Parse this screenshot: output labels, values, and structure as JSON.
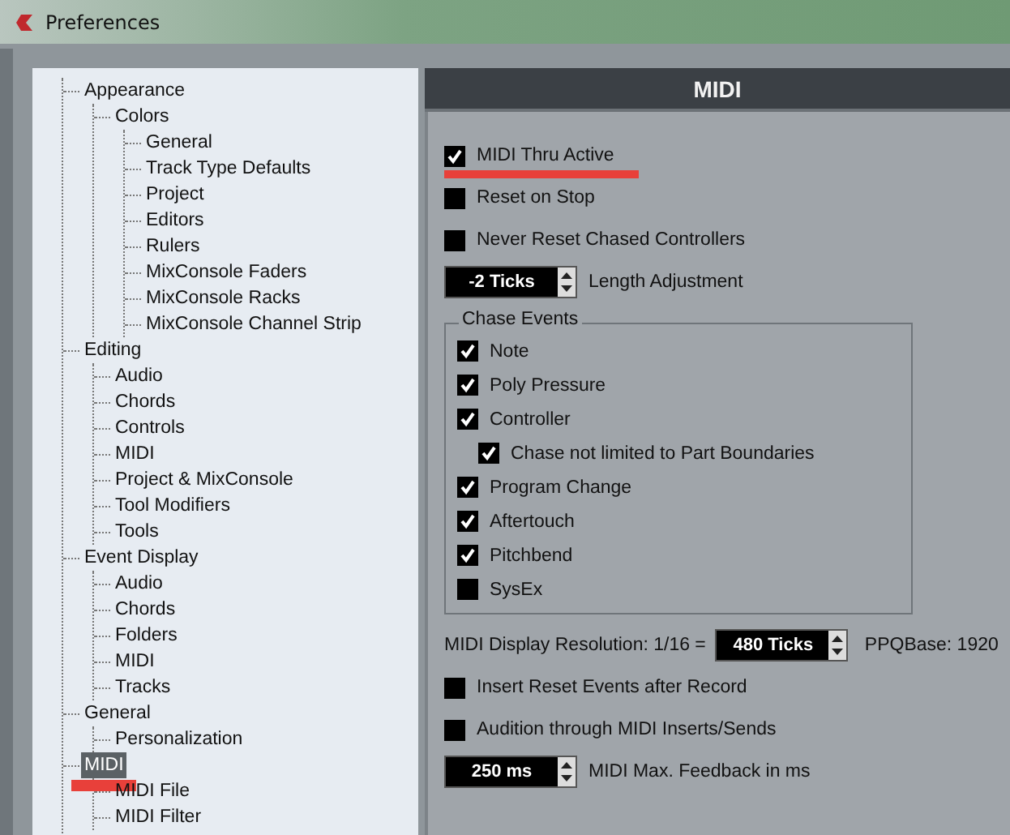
{
  "window": {
    "title": "Preferences"
  },
  "tree": [
    {
      "label": "Appearance",
      "selected": false,
      "children": [
        {
          "label": "Colors",
          "selected": false,
          "children": [
            {
              "label": "General",
              "selected": false
            },
            {
              "label": "Track Type Defaults",
              "selected": false
            },
            {
              "label": "Project",
              "selected": false
            },
            {
              "label": "Editors",
              "selected": false
            },
            {
              "label": "Rulers",
              "selected": false
            },
            {
              "label": "MixConsole Faders",
              "selected": false
            },
            {
              "label": "MixConsole Racks",
              "selected": false
            },
            {
              "label": "MixConsole Channel Strip",
              "selected": false
            }
          ]
        }
      ]
    },
    {
      "label": "Editing",
      "selected": false,
      "children": [
        {
          "label": "Audio",
          "selected": false
        },
        {
          "label": "Chords",
          "selected": false
        },
        {
          "label": "Controls",
          "selected": false
        },
        {
          "label": "MIDI",
          "selected": false
        },
        {
          "label": "Project & MixConsole",
          "selected": false
        },
        {
          "label": "Tool Modifiers",
          "selected": false
        },
        {
          "label": "Tools",
          "selected": false
        }
      ]
    },
    {
      "label": "Event Display",
      "selected": false,
      "children": [
        {
          "label": "Audio",
          "selected": false
        },
        {
          "label": "Chords",
          "selected": false
        },
        {
          "label": "Folders",
          "selected": false
        },
        {
          "label": "MIDI",
          "selected": false
        },
        {
          "label": "Tracks",
          "selected": false
        }
      ]
    },
    {
      "label": "General",
      "selected": false,
      "children": [
        {
          "label": "Personalization",
          "selected": false
        }
      ]
    },
    {
      "label": "MIDI",
      "selected": true,
      "children": [
        {
          "label": "MIDI File",
          "selected": false
        },
        {
          "label": "MIDI Filter",
          "selected": false
        }
      ]
    }
  ],
  "panel": {
    "title": "MIDI",
    "options": [
      {
        "kind": "checkbox",
        "label": "MIDI Thru Active",
        "checked": true
      },
      {
        "kind": "checkbox",
        "label": "Reset on Stop",
        "checked": false
      },
      {
        "kind": "checkbox",
        "label": "Never Reset Chased Controllers",
        "checked": false
      },
      {
        "kind": "spinner",
        "spinner": "-2 Ticks",
        "label": "Length Adjustment"
      }
    ],
    "chase_events": {
      "title": "Chase Events",
      "items": [
        {
          "label": "Note",
          "checked": true
        },
        {
          "label": "Poly Pressure",
          "checked": true
        },
        {
          "label": "Controller",
          "checked": true,
          "children": [
            {
              "label": "Chase not limited to Part Boundaries",
              "checked": true
            }
          ]
        },
        {
          "label": "Program Change",
          "checked": true
        },
        {
          "label": "Aftertouch",
          "checked": true
        },
        {
          "label": "Pitchbend",
          "checked": true
        },
        {
          "label": "SysEx",
          "checked": false
        }
      ]
    },
    "options_after": [
      {
        "kind": "resolution",
        "label": "MIDI Display Resolution: 1/16 =",
        "value": "480 Ticks",
        "note": "PPQBase: 1920"
      },
      {
        "kind": "checkbox",
        "label": "Insert Reset Events after Record",
        "checked": false
      },
      {
        "kind": "checkbox",
        "label": "Audition through MIDI Inserts/Sends",
        "checked": false
      },
      {
        "kind": "spinner",
        "spinner": "250 ms",
        "label": "MIDI Max. Feedback in ms"
      }
    ]
  }
}
